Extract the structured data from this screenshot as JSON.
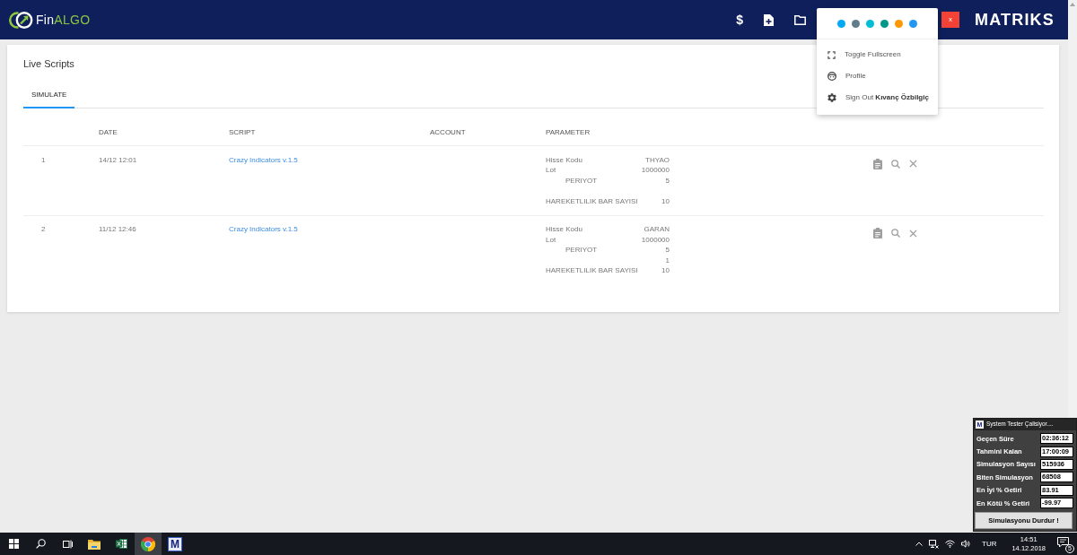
{
  "header": {
    "logo": {
      "parts": [
        {
          "text": "Fin",
          "color": "#ffffff"
        },
        {
          "text": "ALGO",
          "color": "#8dc63f"
        }
      ]
    },
    "tools": [
      {
        "kind": "glyph",
        "label": "$"
      },
      {
        "kind": "new-file"
      },
      {
        "kind": "folder"
      }
    ],
    "close_button": "x",
    "brand": "MATRIKS"
  },
  "menu": {
    "swatches": [
      {
        "color": "#03a9f4"
      },
      {
        "color": "#607d8b"
      },
      {
        "color": "#00bcd4"
      },
      {
        "color": "#009688"
      },
      {
        "color": "#ff9800"
      },
      {
        "color": "#2196f3"
      }
    ],
    "items": [
      {
        "kind": "fullscreen",
        "label": "Toggle Fullscreen"
      },
      {
        "kind": "profile",
        "label": "Profile"
      },
      {
        "kind": "settings",
        "label": "Sign Out **Kıvanç Özbilgiç**"
      }
    ]
  },
  "page": {
    "title": "Live Scripts",
    "tabs": [
      {
        "label": "SIMULATE",
        "selected": true
      }
    ],
    "table": {
      "columns": [
        "DATE",
        "SCRIPT",
        "ACCOUNT",
        "PARAMETER"
      ],
      "rows": [
        {
          "number": "1",
          "date": "14/12 12:01",
          "script": "Crazy Indicators v.1.5",
          "parameters": [
            {
              "kind": "plain",
              "name": "Hisse Kodu",
              "value": "THYAO"
            },
            {
              "kind": "plain",
              "name": "Lot",
              "value": "1000000"
            },
            {
              "kind": "indented",
              "name": "PERIYOT",
              "value": "5"
            },
            {
              "kind": "blank"
            },
            {
              "kind": "plain",
              "name": "HAREKETLILIK BAR SAYISI",
              "value": "10"
            }
          ]
        },
        {
          "number": "2",
          "date": "11/12 12:46",
          "script": "Crazy Indicators v.1.5",
          "parameters": [
            {
              "kind": "plain",
              "name": "Hisse Kodu",
              "value": "GARAN"
            },
            {
              "kind": "plain",
              "name": "Lot",
              "value": "1000000"
            },
            {
              "kind": "indented",
              "name": "PERIYOT",
              "value": "5"
            },
            {
              "kind": "plain",
              "value": "1"
            },
            {
              "kind": "plain",
              "name": "HAREKETLILIK BAR SAYISI",
              "value": "10"
            }
          ]
        }
      ]
    }
  },
  "tester": {
    "logo": "M",
    "title": "System Tester Çalisiyor....",
    "stats": [
      {
        "label": "Geçen Süre",
        "value": "02:36:12"
      },
      {
        "label": "Tahmini Kalan",
        "value": "17:00:09"
      },
      {
        "label": "Simulasyon Sayısı",
        "value": "515936"
      },
      {
        "label": "Biten Simulasyon",
        "value": "68508"
      },
      {
        "label": "En İyi % Getiri",
        "value": "83.91"
      },
      {
        "label": "En Kötü % Getiri",
        "value": "-99.97"
      }
    ],
    "button": "Simulasyonu Durdur !"
  },
  "taskbar": {
    "apps": [
      {
        "kind": "folder",
        "selected": false
      },
      {
        "kind": "spreadsheet",
        "selected": false
      },
      {
        "kind": "browser",
        "selected": true
      },
      {
        "kind": "letter-tile",
        "label": "M",
        "selected": false
      }
    ],
    "tray": {
      "language": "TUR",
      "time": "14:51",
      "date": "14.12.2018",
      "notifications": "5"
    }
  }
}
